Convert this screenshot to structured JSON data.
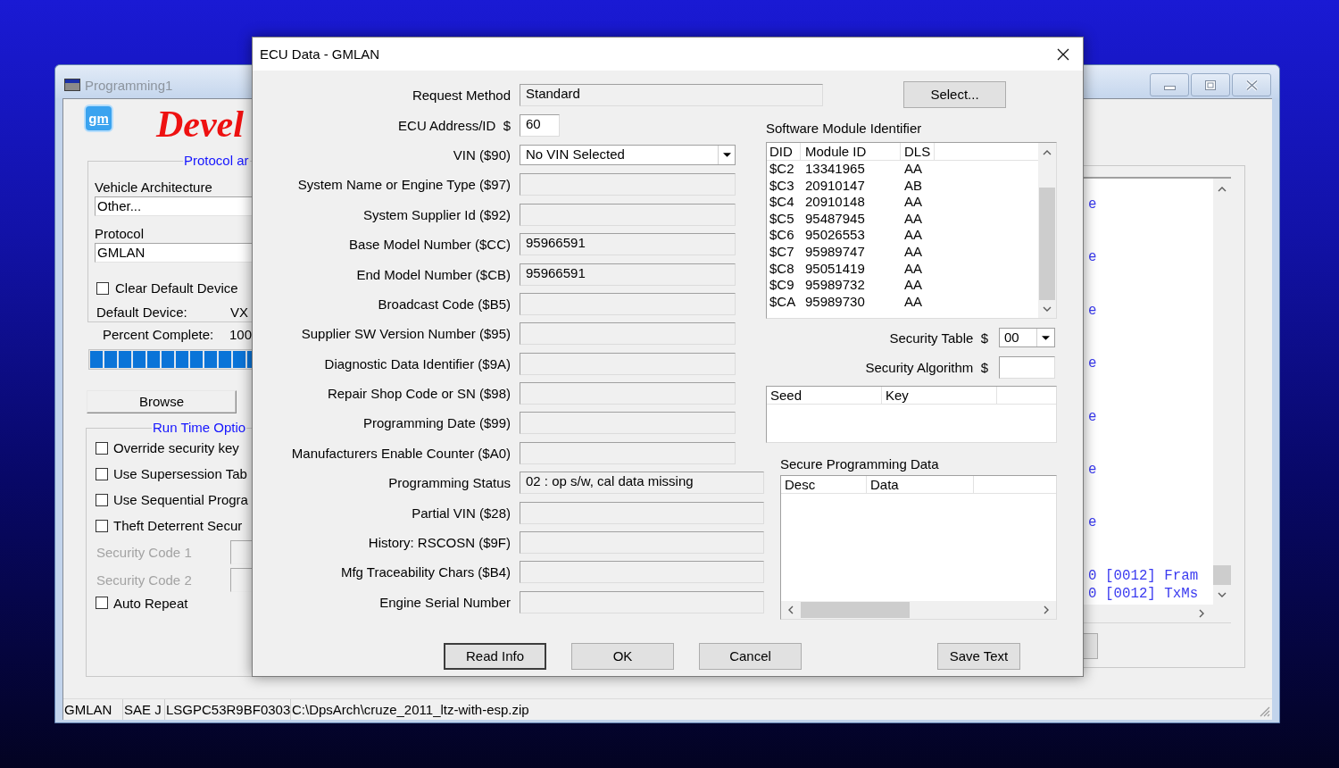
{
  "background_window": {
    "title": "Programming1",
    "logo": {
      "text": "gm"
    },
    "banner": "Devel",
    "protocol_group": {
      "legend": "Protocol ar",
      "vehicle_architecture": {
        "label": "Vehicle Architecture",
        "value": "Other..."
      },
      "protocol": {
        "label": "Protocol",
        "value": "GMLAN"
      },
      "clear_default_device": {
        "label": "Clear Default Device",
        "checked": false
      },
      "default_device": {
        "label": "Default Device:",
        "value": "VX"
      }
    },
    "percent_complete": {
      "label": "Percent Complete:",
      "value": "100",
      "level": 1
    },
    "browse_button": "Browse",
    "run_time_options": {
      "legend": "Run Time Optio",
      "items": [
        {
          "kind": "checkbox",
          "label": "Override security key",
          "checked": false
        },
        {
          "kind": "checkbox",
          "label": "Use Supersession Tab",
          "checked": false
        },
        {
          "kind": "checkbox",
          "label": "Use Sequential Progra",
          "checked": false
        },
        {
          "kind": "checkbox",
          "label": "Theft Deterrent Secur",
          "checked": false
        },
        {
          "kind": "code",
          "label": "Security Code 1",
          "disabled": true
        },
        {
          "kind": "code",
          "label": "Security Code 2",
          "disabled": true
        },
        {
          "kind": "checkbox",
          "label": "Auto Repeat",
          "checked": false
        }
      ]
    },
    "log": {
      "lines": [
        {
          "kind": "tail",
          "text": "e"
        },
        {
          "kind": "tail",
          "text": "e"
        },
        {
          "kind": "tail",
          "text": "e"
        },
        {
          "kind": "tail",
          "text": "e"
        },
        {
          "kind": "tail",
          "text": "e"
        },
        {
          "kind": "tail",
          "text": "e"
        },
        {
          "kind": "tail",
          "text": "e"
        },
        {
          "kind": "line",
          "text": "0 [0012] Fram"
        },
        {
          "kind": "line",
          "text": "0 [0012] TxMs"
        }
      ]
    },
    "status_bar": [
      "GMLAN",
      "SAE J",
      "LSGPC53R9BF0303",
      "C:\\DpsArch\\cruze_2011_ltz-with-esp.zip"
    ]
  },
  "dialog": {
    "title": "ECU Data - GMLAN",
    "fields": [
      {
        "label": "Request Method",
        "kind": "readonly",
        "value": "Standard"
      },
      {
        "label": "ECU Address/ID  $",
        "kind": "input",
        "value": "60"
      },
      {
        "label": "VIN ($90)",
        "kind": "select",
        "value": "No VIN Selected"
      },
      {
        "label": "System Name or Engine Type ($97)",
        "kind": "readonly"
      },
      {
        "label": "System Supplier Id ($92)",
        "kind": "readonly"
      },
      {
        "label": "Base Model Number ($CC)",
        "kind": "readonly",
        "value": "95966591"
      },
      {
        "label": "End Model Number ($CB)",
        "kind": "readonly",
        "value": "95966591"
      },
      {
        "label": "Broadcast Code ($B5)",
        "kind": "readonly"
      },
      {
        "label": "Supplier SW Version Number ($95)",
        "kind": "readonly"
      },
      {
        "label": "Diagnostic Data Identifier ($9A)",
        "kind": "readonly"
      },
      {
        "label": "Repair Shop Code or SN ($98)",
        "kind": "readonly"
      },
      {
        "label": "Programming Date ($99)",
        "kind": "readonly"
      },
      {
        "label": "Manufacturers Enable Counter ($A0)",
        "kind": "readonly"
      },
      {
        "label": "Programming Status",
        "kind": "readonly",
        "value": "02 : op s/w, cal data missing"
      },
      {
        "label": "Partial VIN ($28)",
        "kind": "readonly"
      },
      {
        "label": "History: RSCOSN ($9F)",
        "kind": "readonly"
      },
      {
        "label": "Mfg Traceability Chars ($B4)",
        "kind": "readonly"
      },
      {
        "label": "Engine Serial Number",
        "kind": "readonly"
      }
    ],
    "select_button": "Select...",
    "software_module_identifier": {
      "title": "Software Module Identifier",
      "columns": [
        "DID",
        "Module ID",
        "DLS"
      ],
      "rows": [
        [
          "$C2",
          "13341965",
          "AA"
        ],
        [
          "$C3",
          "20910147",
          "AB"
        ],
        [
          "$C4",
          "20910148",
          "AA"
        ],
        [
          "$C5",
          "95487945",
          "AA"
        ],
        [
          "$C6",
          "95026553",
          "AA"
        ],
        [
          "$C7",
          "95989747",
          "AA"
        ],
        [
          "$C8",
          "95051419",
          "AA"
        ],
        [
          "$C9",
          "95989732",
          "AA"
        ],
        [
          "$CA",
          "95989730",
          "AA"
        ]
      ]
    },
    "security_table": {
      "label": "Security Table  $",
      "value": "00"
    },
    "security_algorithm": {
      "label": "Security Algorithm  $"
    },
    "seed_key": {
      "columns": [
        "Seed",
        "Key"
      ]
    },
    "secure_programming_data": {
      "title": "Secure Programming Data",
      "columns": [
        "Desc",
        "Data"
      ]
    },
    "buttons": [
      {
        "label": "Read Info",
        "default": true
      },
      {
        "label": "OK",
        "default": false
      },
      {
        "label": "Cancel",
        "default": false
      },
      {
        "label": "Save Text",
        "default": false
      }
    ]
  }
}
